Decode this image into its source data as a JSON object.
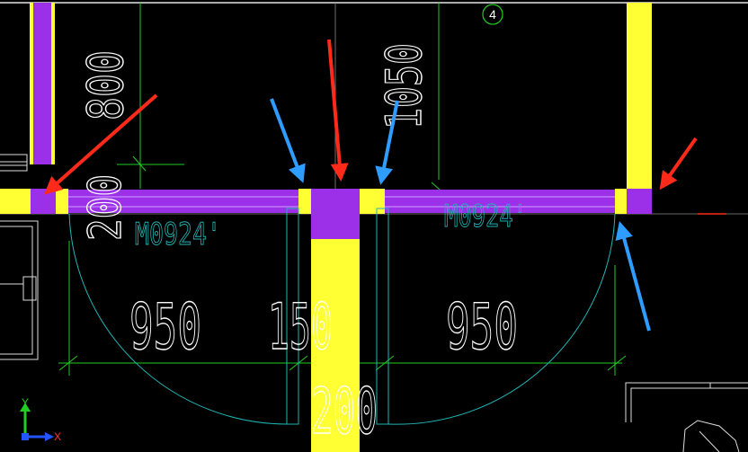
{
  "drawing": {
    "grid_bubble": "4",
    "dimensions": {
      "top_left": "800",
      "left_vertical": "200",
      "top_right": "1050",
      "left_door_width": "950",
      "center_pier": "150",
      "right_door_width": "950",
      "bottom_wall": "200"
    },
    "door_tags": {
      "left": "M0924'",
      "right": "M0924'"
    },
    "ucs": {
      "y_label": "Y",
      "x_label": "X"
    }
  },
  "colors": {
    "background": "#000000",
    "wall_yellow": "#ffff33",
    "beam_purple": "#9b30e8",
    "dimension_green": "#22cc22",
    "door_cyan": "#1fb5b5",
    "arrow_red": "#ff2a1a",
    "arrow_blue": "#2f9cff",
    "text_white": "#ffffff"
  }
}
